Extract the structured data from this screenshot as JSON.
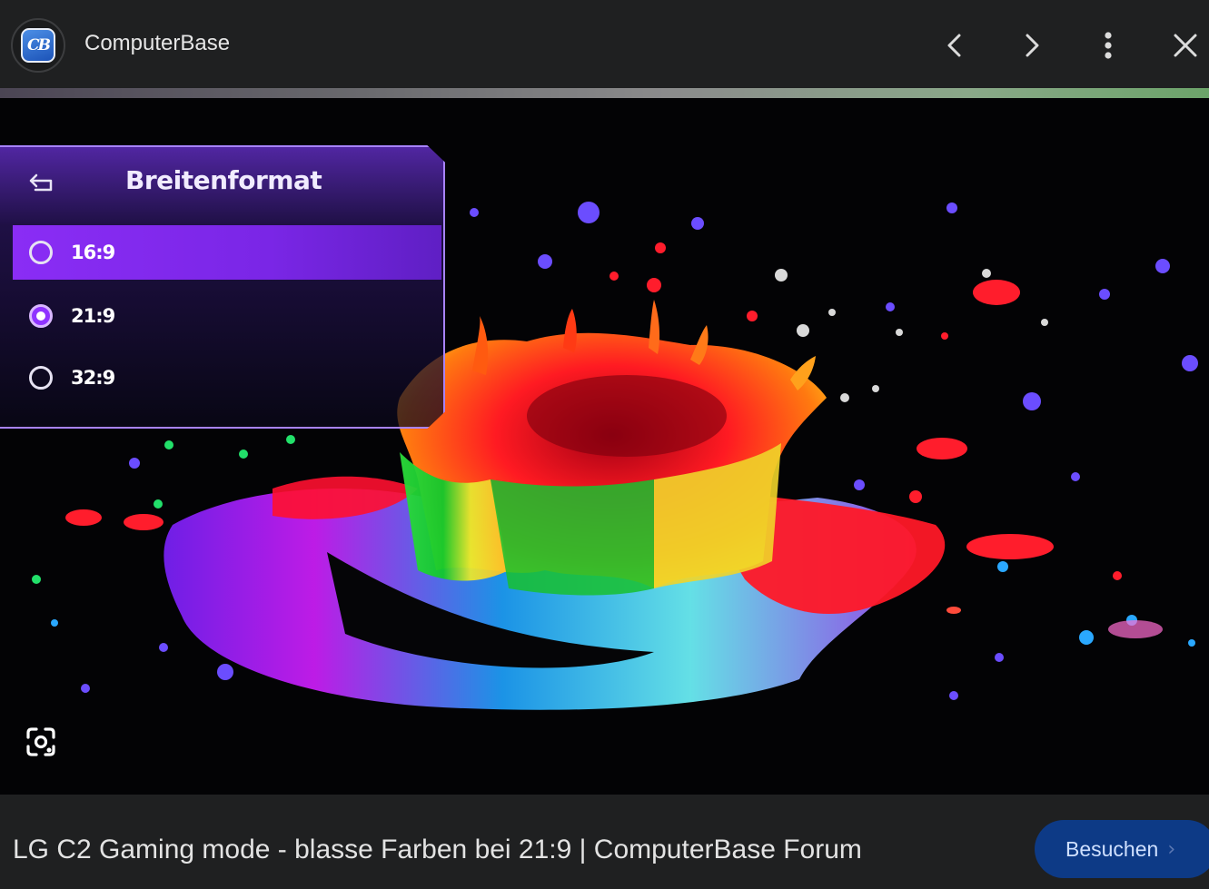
{
  "header": {
    "favicon_text": "CB",
    "site_name": "ComputerBase",
    "icons": [
      "chevron-left-icon",
      "chevron-right-icon",
      "more-vert-icon",
      "close-icon"
    ]
  },
  "image_overlay": {
    "menu_title": "Breitenformat",
    "options": [
      {
        "label": "16:9",
        "state": "highlighted"
      },
      {
        "label": "21:9",
        "state": "selected"
      },
      {
        "label": "32:9",
        "state": "unselected"
      }
    ]
  },
  "footer": {
    "page_title": "LG C2 Gaming mode - blasse Farben bei 21:9 | ComputerBase Forum",
    "visit_label": "Besuchen",
    "visit_chevron": "›"
  },
  "colors": {
    "background": "#1f2021",
    "menu_accent": "#8a2df5",
    "visit_button": "#0d3a86"
  }
}
